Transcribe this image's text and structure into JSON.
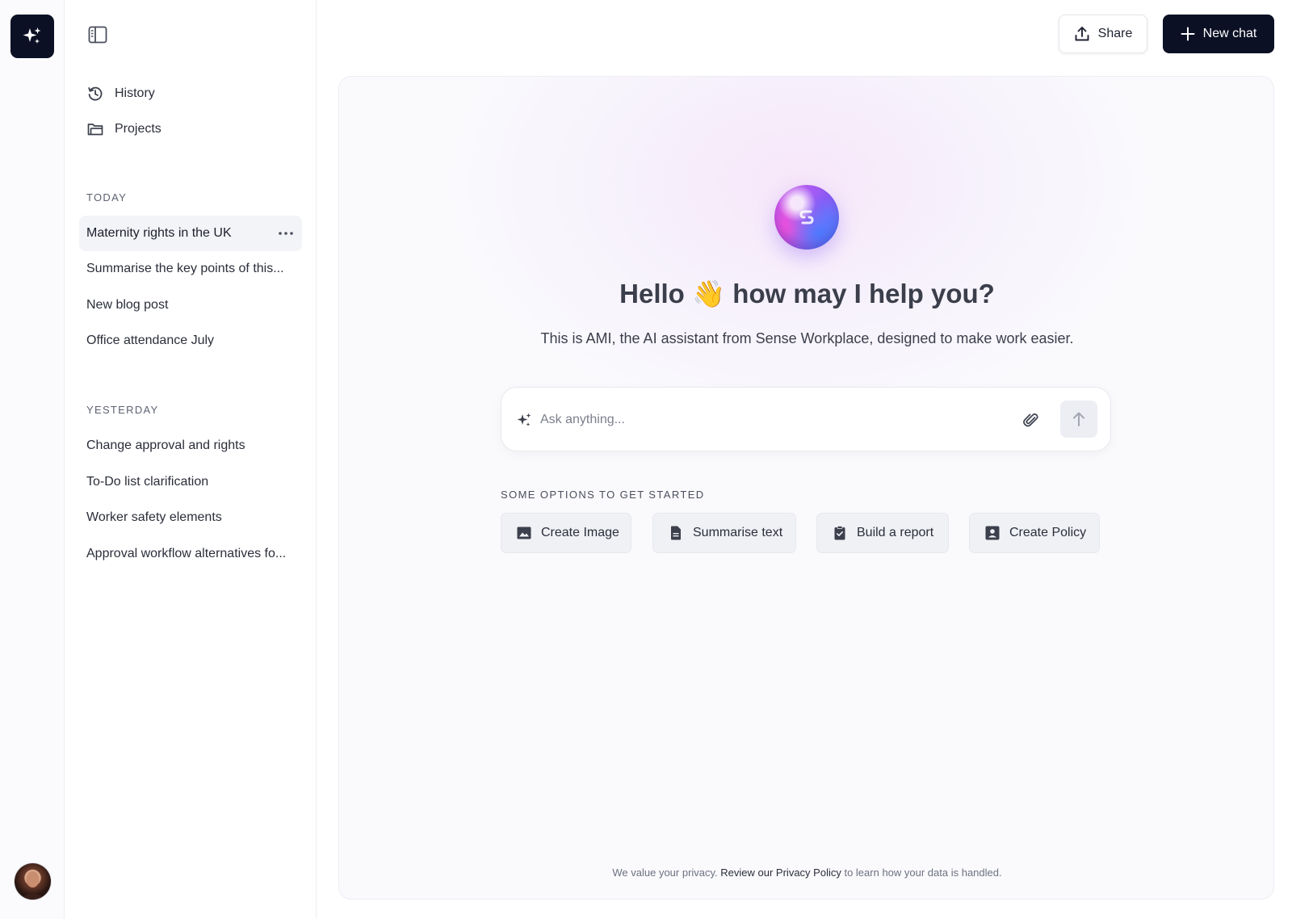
{
  "header": {
    "share_label": "Share",
    "new_chat_label": "New chat"
  },
  "sidebar": {
    "nav": [
      {
        "label": "History",
        "icon": "history-icon"
      },
      {
        "label": "Projects",
        "icon": "folder-icon"
      }
    ],
    "sections": [
      {
        "label": "TODAY",
        "items": [
          {
            "label": "Maternity rights in the UK",
            "active": true
          },
          {
            "label": "Summarise the key points of this..."
          },
          {
            "label": "New blog post"
          },
          {
            "label": "Office attendance July"
          }
        ]
      },
      {
        "label": "YESTERDAY",
        "items": [
          {
            "label": "Change approval and rights"
          },
          {
            "label": "To-Do list clarification"
          },
          {
            "label": "Worker safety elements"
          },
          {
            "label": "Approval workflow alternatives fo..."
          }
        ]
      }
    ]
  },
  "main": {
    "greeting_hello": "Hello",
    "greeting_emoji": "👋",
    "greeting_rest": "how may I help you?",
    "subtitle": "This is AMI, the AI assistant from Sense Workplace, designed to make work easier.",
    "ask_placeholder": "Ask anything...",
    "options_label": "SOME OPTIONS TO GET STARTED",
    "options": [
      {
        "label": "Create Image",
        "icon": "image-icon"
      },
      {
        "label": "Summarise text",
        "icon": "document-icon"
      },
      {
        "label": "Build a report",
        "icon": "clipboard-icon"
      },
      {
        "label": "Create Policy",
        "icon": "contact-book-icon"
      }
    ],
    "privacy": {
      "pre": "We value your privacy.",
      "link": "Review our Privacy Policy",
      "post": "to learn how your data is handled."
    }
  },
  "colors": {
    "brand_dark": "#0b1024",
    "panel_bg": "#fafafd",
    "orb_purple": "#8c5cf6",
    "orb_pink": "#e05cf0"
  }
}
